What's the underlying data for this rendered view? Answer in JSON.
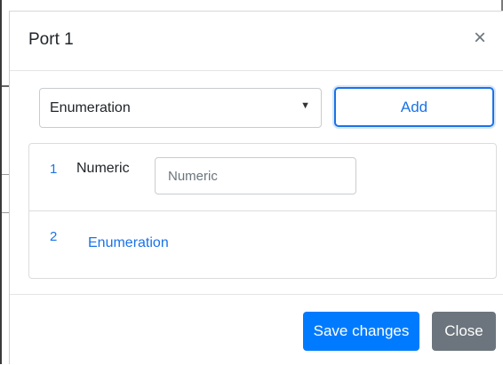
{
  "modal": {
    "title": "Port 1",
    "close_icon_glyph": "×",
    "close_icon": "close-icon"
  },
  "toolbar": {
    "select_value": "Enumeration",
    "select_caret_glyph": "▼",
    "add_label": "Add"
  },
  "items": [
    {
      "index": "1",
      "label": "Numeric",
      "input_placeholder": "Numeric"
    },
    {
      "index": "2",
      "link": "Enumeration"
    }
  ],
  "footer": {
    "save_label": "Save changes",
    "close_label": "Close"
  },
  "colors": {
    "primary": "#007bff",
    "link": "#1a73e8",
    "secondary": "#6c757d"
  }
}
